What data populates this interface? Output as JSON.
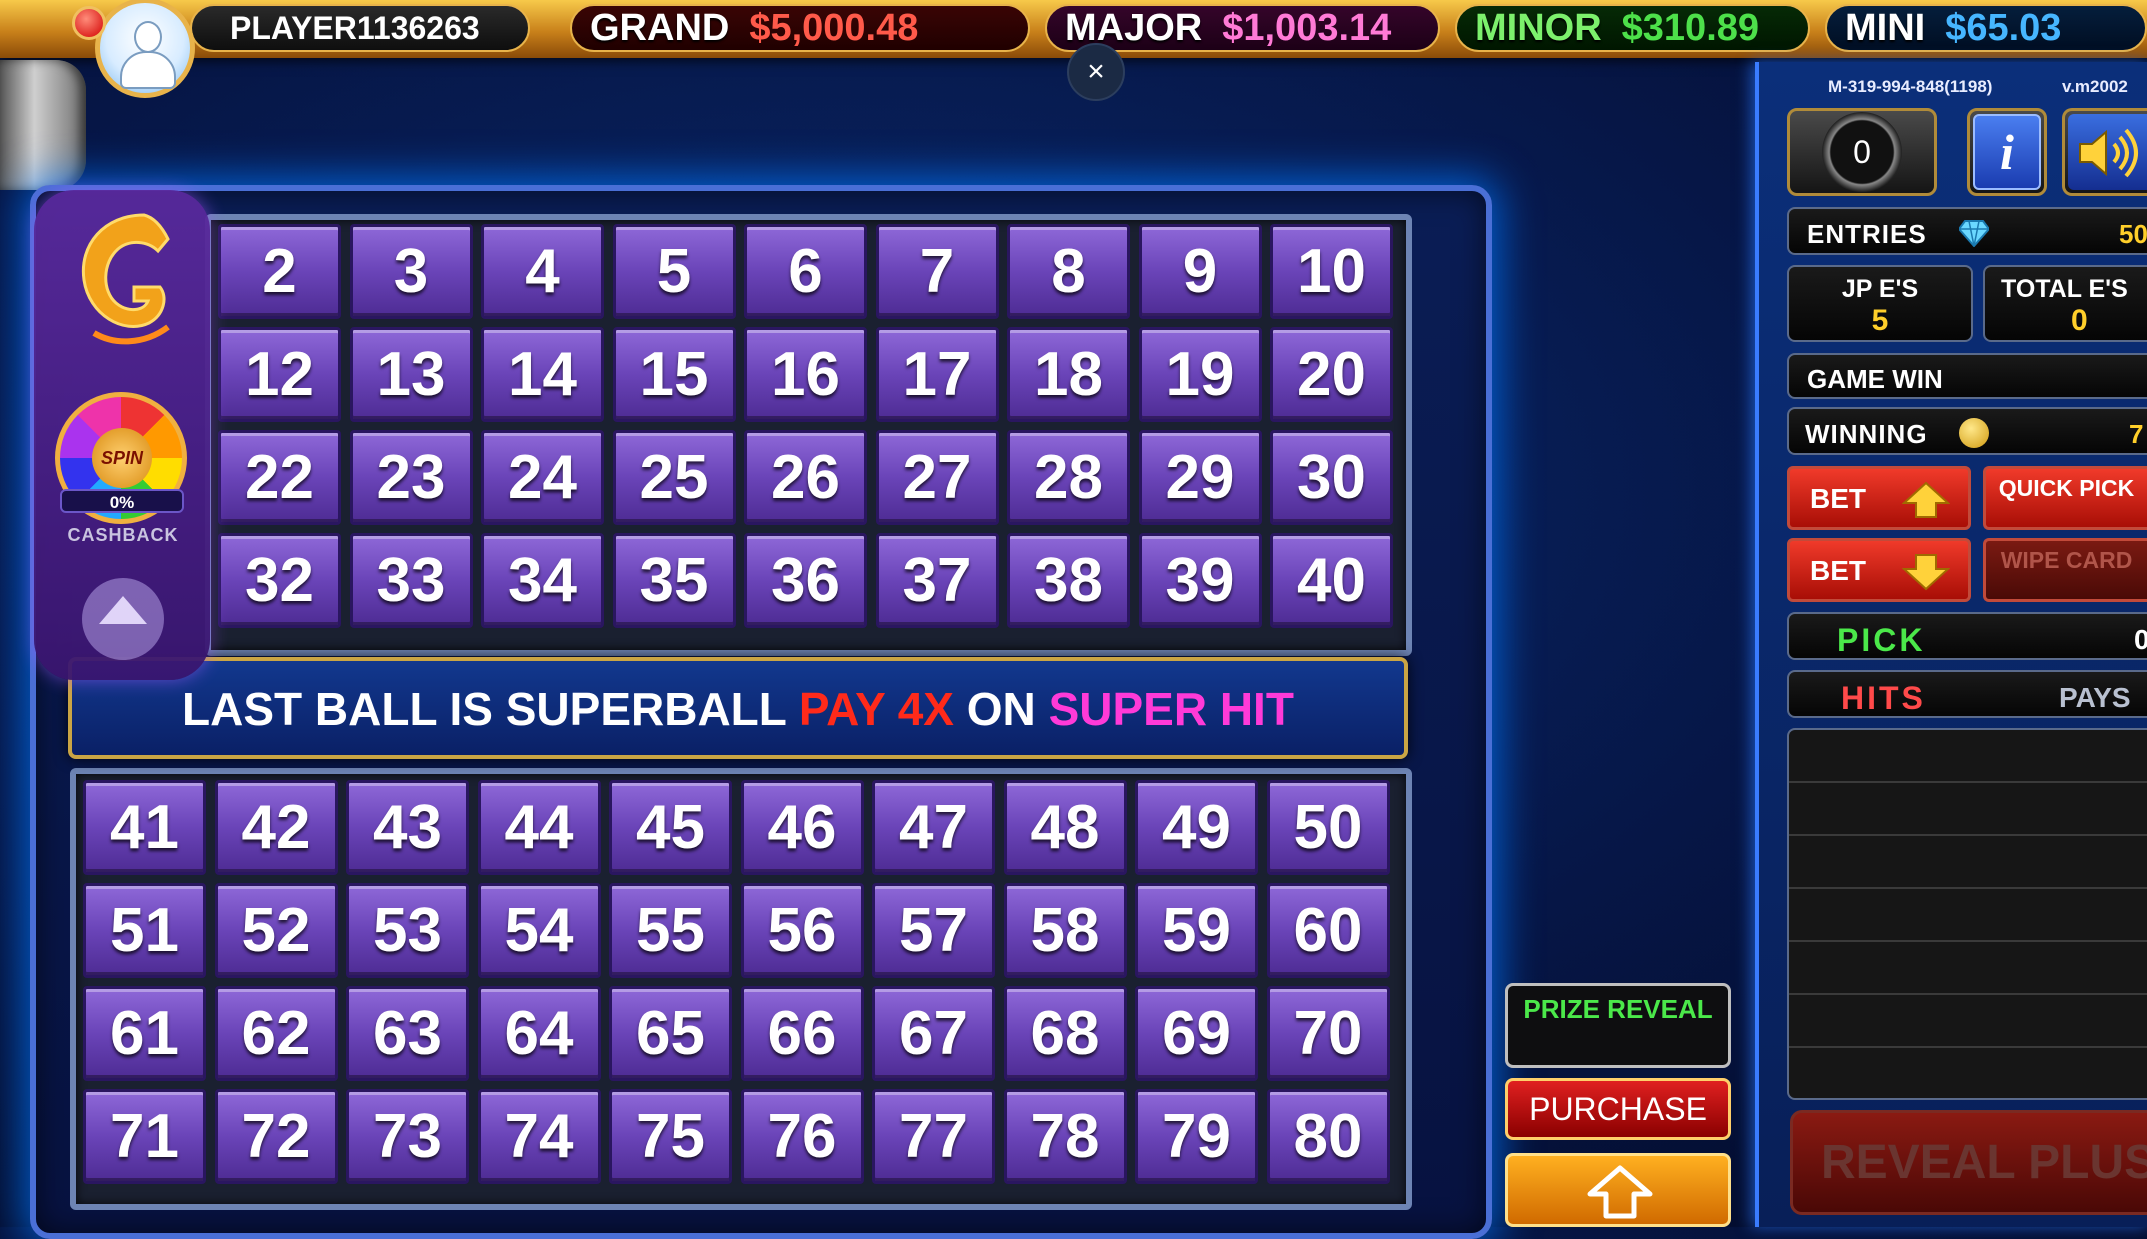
{
  "header": {
    "player": "PLAYER1136263",
    "jackpots": [
      {
        "name": "GRAND",
        "value": "$5,000.48"
      },
      {
        "name": "MAJOR",
        "value": "$1,003.14"
      },
      {
        "name": "MINOR",
        "value": "$310.89"
      },
      {
        "name": "MINI",
        "value": "$65.03"
      }
    ],
    "close_icon": "×"
  },
  "board": {
    "top_numbers": [
      2,
      3,
      4,
      5,
      6,
      7,
      8,
      9,
      10,
      12,
      13,
      14,
      15,
      16,
      17,
      18,
      19,
      20,
      22,
      23,
      24,
      25,
      26,
      27,
      28,
      29,
      30,
      32,
      33,
      34,
      35,
      36,
      37,
      38,
      39,
      40
    ],
    "bottom_numbers": [
      41,
      42,
      43,
      44,
      45,
      46,
      47,
      48,
      49,
      50,
      51,
      52,
      53,
      54,
      55,
      56,
      57,
      58,
      59,
      60,
      61,
      62,
      63,
      64,
      65,
      66,
      67,
      68,
      69,
      70,
      71,
      72,
      73,
      74,
      75,
      76,
      77,
      78,
      79,
      80
    ],
    "banner": {
      "part1": "LAST BALL IS SUPERBALL",
      "part2": "PAY 4X",
      "part3": "ON",
      "part4": "SUPER HIT"
    }
  },
  "side_panel": {
    "spin_label": "SPIN",
    "cashback_pct": "0%",
    "cashback_label": "CASHBACK"
  },
  "center_buttons": {
    "prize_reveal": "PRIZE REVEAL",
    "purchase": "PURCHASE"
  },
  "right_panel": {
    "machine_id": "M-319-994-848(1198)",
    "version": "v.m2002",
    "gauge_value": "0",
    "info_label": "i",
    "entries_label": "ENTRIES",
    "entries_value": "50",
    "jp_entries_label": "JP E'S",
    "jp_entries_value": "5",
    "total_entries_label": "TOTAL E'S",
    "total_entries_value": "0",
    "game_win_label": "GAME WIN",
    "winning_label": "WINNING",
    "winning_value": "7",
    "bet_up_label": "BET",
    "bet_down_label": "BET",
    "quick_pick_label": "QUICK PICK",
    "wipe_card_label": "WIPE CARD",
    "pick_label": "PICK",
    "pick_value": "0",
    "hits_label": "HITS",
    "pays_label": "PAYS",
    "reveal_plus_label": "REVEAL PLUS"
  },
  "colors": {
    "cell_purple": "#6a44b8",
    "grand_red": "#ff5a4a",
    "major_pink": "#ff7ad6",
    "minor_green": "#4de04a",
    "mini_blue": "#46b6ff"
  }
}
